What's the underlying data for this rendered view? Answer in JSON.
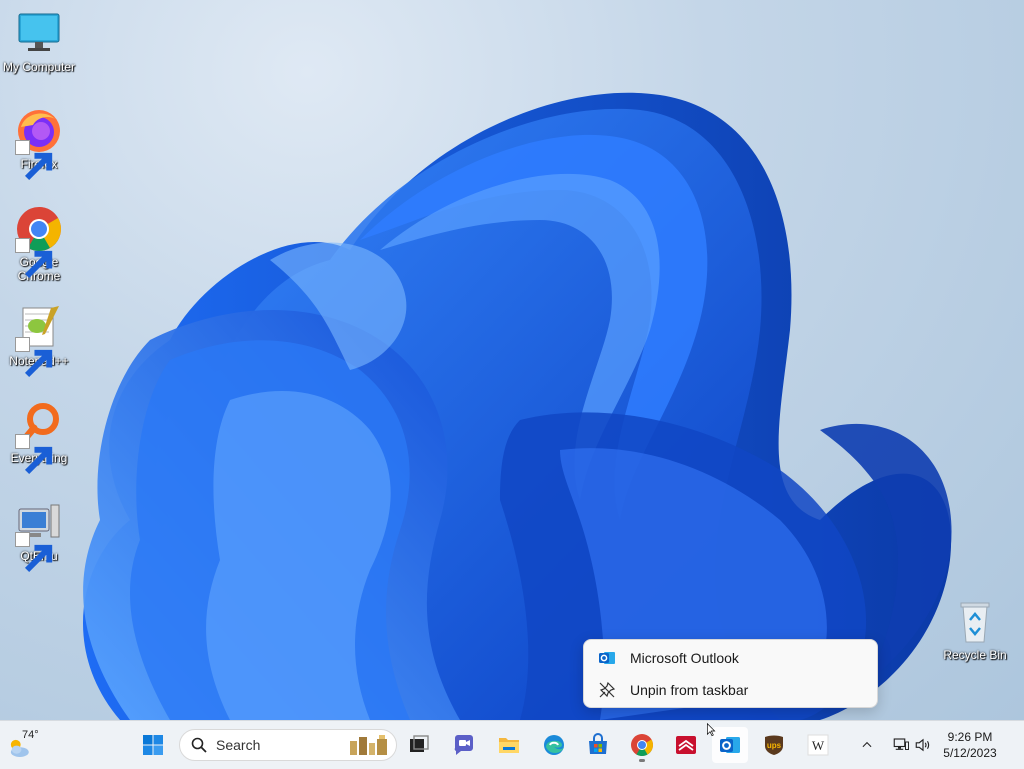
{
  "desktop": {
    "icons": [
      {
        "label": "My Computer",
        "icon": "monitor-icon"
      },
      {
        "label": "Firefox",
        "icon": "firefox-icon"
      },
      {
        "label": "Google Chrome",
        "icon": "chrome-icon"
      },
      {
        "label": "Notepad++",
        "icon": "notepadpp-icon"
      },
      {
        "label": "Everything",
        "icon": "everything-icon"
      },
      {
        "label": "QtEmu",
        "icon": "qtemu-icon"
      }
    ],
    "recycle_bin": {
      "label": "Recycle Bin",
      "icon": "recycle-bin-icon"
    }
  },
  "context_menu": {
    "items": [
      {
        "label": "Microsoft Outlook",
        "icon": "outlook-icon"
      },
      {
        "label": "Unpin from taskbar",
        "icon": "unpin-icon"
      }
    ]
  },
  "taskbar": {
    "weather": {
      "temp": "74°",
      "icon": "partly-cloudy-icon"
    },
    "search": {
      "placeholder": "Search"
    },
    "apps": [
      {
        "name": "Start",
        "icon": "windows-start-icon"
      },
      {
        "name": "Task View",
        "icon": "task-view-icon"
      },
      {
        "name": "Chat",
        "icon": "chat-icon"
      },
      {
        "name": "File Explorer",
        "icon": "folder-icon"
      },
      {
        "name": "Microsoft Edge",
        "icon": "edge-icon"
      },
      {
        "name": "Microsoft Store",
        "icon": "store-icon"
      },
      {
        "name": "Google Chrome",
        "icon": "chrome-icon"
      },
      {
        "name": "Bank of America",
        "icon": "bank-icon"
      },
      {
        "name": "Microsoft Outlook",
        "icon": "outlook-icon"
      },
      {
        "name": "UPS",
        "icon": "ups-icon"
      },
      {
        "name": "Wikipedia",
        "icon": "wikipedia-icon"
      }
    ],
    "ups_text": "ups",
    "wiki_text": "W",
    "tray": {
      "time": "9:26 PM",
      "date": "5/12/2023"
    }
  },
  "colors": {
    "accent": "#0067c0",
    "wallpaper_blue": "#1a6ef0",
    "taskbar_bg": "#eef2f6"
  }
}
